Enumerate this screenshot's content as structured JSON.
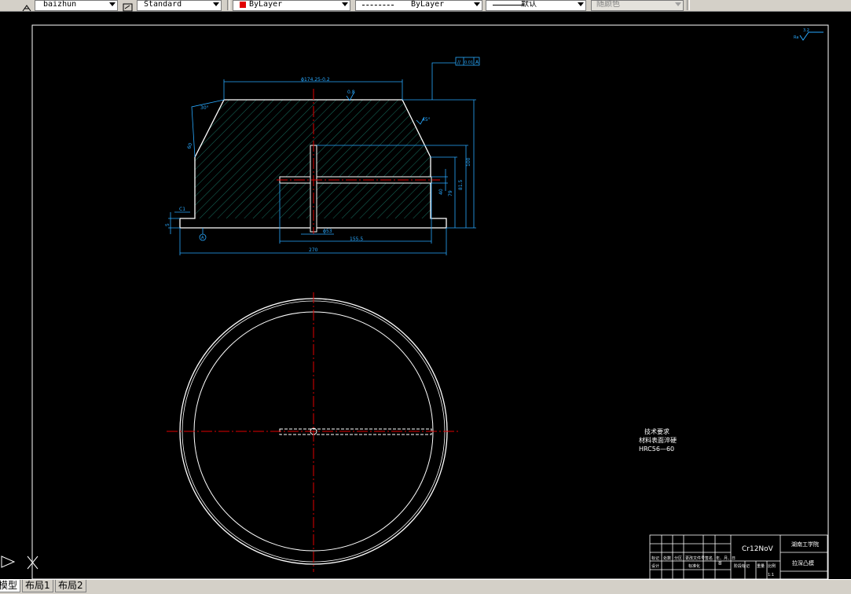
{
  "toolbar": {
    "dim_style": "baizhun",
    "text_style": "Standard",
    "color": "ByLayer",
    "color_hex": "#e00000",
    "linetype": "ByLayer",
    "lineweight": "默认",
    "plotstyle": "随颜色"
  },
  "tabs": [
    "模型",
    "布局1",
    "布局2"
  ],
  "drawing": {
    "dims": {
      "top_width": "ϕ174.25-0.2",
      "surface_roughness": "0.8",
      "angle_left": "30°",
      "angle_chamfer": "45°",
      "hole_dia": "ϕ53",
      "slot_len": "155.5",
      "total_width": "270",
      "height_total": "100",
      "height_mid": "79",
      "height_inner": "81.5",
      "height_slot": "40",
      "chamfer_left": "C1",
      "step": "5",
      "left_length": "60",
      "fcf_symbol": "//",
      "fcf_value": "0.01",
      "fcf_datum": "A",
      "datum_label": "A"
    },
    "roughness_corner": "3.2",
    "tech_title": "技术要求",
    "tech_line1": "材料表面淬硬",
    "tech_line2": "HRC56—60",
    "title_block": {
      "material": "Cr12NoV",
      "school": "湖南工学院",
      "part_name": "拉深凸模",
      "heads": [
        "标记",
        "处数",
        "分区",
        "更改文件号",
        "签名",
        "年、月、日"
      ],
      "row2": [
        "设计",
        "标准化"
      ],
      "stage_label": "阶段标记",
      "weight_label": "重量",
      "scale_label": "比例",
      "scale_value": "1:1",
      "sheet": "8"
    }
  }
}
